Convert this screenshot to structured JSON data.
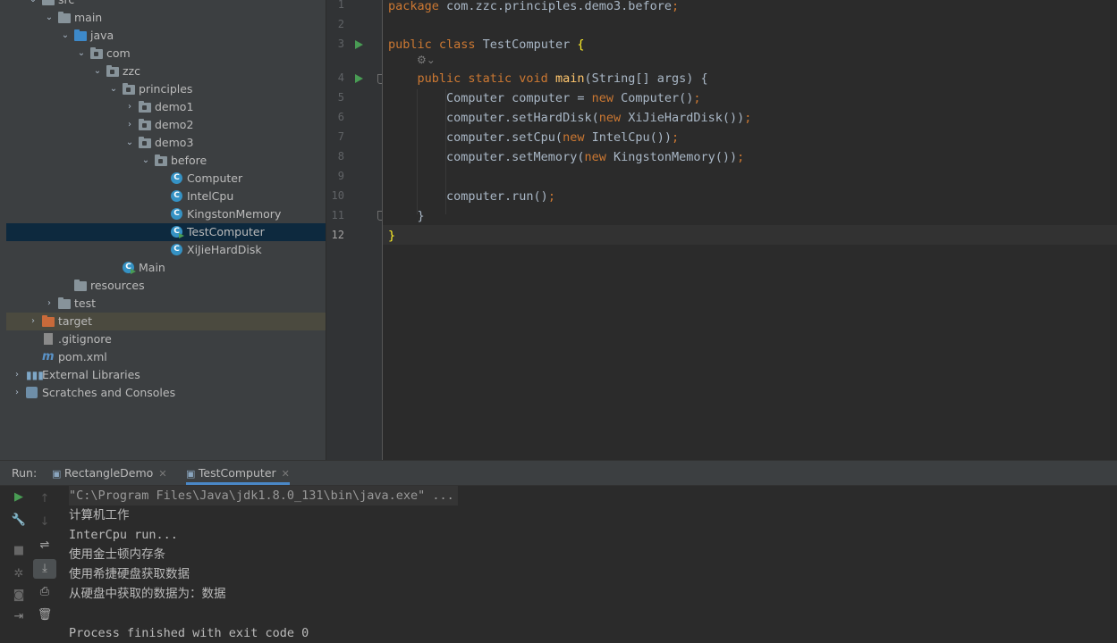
{
  "project_tree": [
    {
      "label": "src",
      "depth": 1,
      "arrow": "down",
      "icon": "folder-icon",
      "state": ""
    },
    {
      "label": "main",
      "depth": 2,
      "arrow": "down",
      "icon": "folder-icon",
      "state": ""
    },
    {
      "label": "java",
      "depth": 3,
      "arrow": "down",
      "icon": "source-folder-icon",
      "state": ""
    },
    {
      "label": "com",
      "depth": 4,
      "arrow": "down",
      "icon": "package-icon",
      "state": ""
    },
    {
      "label": "zzc",
      "depth": 5,
      "arrow": "down",
      "icon": "package-icon",
      "state": ""
    },
    {
      "label": "principles",
      "depth": 6,
      "arrow": "down",
      "icon": "package-icon",
      "state": ""
    },
    {
      "label": "demo1",
      "depth": 7,
      "arrow": "right",
      "icon": "package-icon",
      "state": ""
    },
    {
      "label": "demo2",
      "depth": 7,
      "arrow": "right",
      "icon": "package-icon",
      "state": ""
    },
    {
      "label": "demo3",
      "depth": 7,
      "arrow": "down",
      "icon": "package-icon",
      "state": ""
    },
    {
      "label": "before",
      "depth": 8,
      "arrow": "down",
      "icon": "package-icon",
      "state": ""
    },
    {
      "label": "Computer",
      "depth": 9,
      "arrow": "",
      "icon": "class-icon",
      "state": ""
    },
    {
      "label": "IntelCpu",
      "depth": 9,
      "arrow": "",
      "icon": "class-icon",
      "state": ""
    },
    {
      "label": "KingstonMemory",
      "depth": 9,
      "arrow": "",
      "icon": "class-icon",
      "state": ""
    },
    {
      "label": "TestComputer",
      "depth": 9,
      "arrow": "",
      "icon": "runnable-class-icon",
      "state": "selected"
    },
    {
      "label": "XiJieHardDisk",
      "depth": 9,
      "arrow": "",
      "icon": "class-icon",
      "state": ""
    },
    {
      "label": "Main",
      "depth": 6,
      "arrow": "",
      "icon": "runnable-class-icon",
      "state": ""
    },
    {
      "label": "resources",
      "depth": 3,
      "arrow": "",
      "icon": "resources-folder-icon",
      "state": ""
    },
    {
      "label": "test",
      "depth": 2,
      "arrow": "right",
      "icon": "folder-icon",
      "state": ""
    },
    {
      "label": "target",
      "depth": 1,
      "arrow": "right",
      "icon": "excluded-folder-icon",
      "state": "excluded"
    },
    {
      "label": ".gitignore",
      "depth": 1,
      "arrow": "",
      "icon": "gitignore-file-icon",
      "state": ""
    },
    {
      "label": "pom.xml",
      "depth": 1,
      "arrow": "",
      "icon": "maven-file-icon",
      "state": ""
    },
    {
      "label": "External Libraries",
      "depth": 0,
      "arrow": "right",
      "icon": "libraries-icon",
      "state": ""
    },
    {
      "label": "Scratches and Consoles",
      "depth": 0,
      "arrow": "right",
      "icon": "scratches-icon",
      "state": ""
    }
  ],
  "editor": {
    "line_numbers": [
      "1",
      "2",
      "3",
      "4",
      "5",
      "6",
      "7",
      "8",
      "9",
      "10",
      "11",
      "12"
    ],
    "current_line": "12",
    "code_lines": [
      [
        {
          "t": "package ",
          "c": "kw"
        },
        {
          "t": "com.zzc.principles.demo3.before",
          "c": ""
        },
        {
          "t": ";",
          "c": "kw"
        }
      ],
      [],
      [
        {
          "t": "public class ",
          "c": "kw"
        },
        {
          "t": "TestComputer ",
          "c": ""
        },
        {
          "t": "{",
          "c": "br"
        }
      ],
      [
        {
          "t": "    public static void ",
          "c": "kw"
        },
        {
          "t": "main",
          "c": "fn"
        },
        {
          "t": "(String[] args) {",
          "c": ""
        }
      ],
      [
        {
          "t": "        Computer computer = ",
          "c": ""
        },
        {
          "t": "new ",
          "c": "kw"
        },
        {
          "t": "Computer()",
          "c": ""
        },
        {
          "t": ";",
          "c": "kw"
        }
      ],
      [
        {
          "t": "        computer.setHardDisk(",
          "c": ""
        },
        {
          "t": "new ",
          "c": "kw"
        },
        {
          "t": "XiJieHardDisk())",
          "c": ""
        },
        {
          "t": ";",
          "c": "kw"
        }
      ],
      [
        {
          "t": "        computer.setCpu(",
          "c": ""
        },
        {
          "t": "new ",
          "c": "kw"
        },
        {
          "t": "IntelCpu())",
          "c": ""
        },
        {
          "t": ";",
          "c": "kw"
        }
      ],
      [
        {
          "t": "        computer.setMemory(",
          "c": ""
        },
        {
          "t": "new ",
          "c": "kw"
        },
        {
          "t": "KingstonMemory())",
          "c": ""
        },
        {
          "t": ";",
          "c": "kw"
        }
      ],
      [],
      [
        {
          "t": "        computer.run()",
          "c": ""
        },
        {
          "t": ";",
          "c": "kw"
        }
      ],
      [
        {
          "t": "    }",
          "c": ""
        }
      ],
      [
        {
          "t": "}",
          "c": "br"
        }
      ]
    ]
  },
  "run_panel": {
    "title": "Run:",
    "tabs": [
      {
        "label": "RectangleDemo",
        "active": false
      },
      {
        "label": "TestComputer",
        "active": true
      }
    ],
    "console_lines": [
      "\"C:\\Program Files\\Java\\jdk1.8.0_131\\bin\\java.exe\" ...",
      "计算机工作",
      "InterCpu run...",
      "使用金士顿内存条",
      "使用希捷硬盘获取数据",
      "从硬盘中获取的数据为：数据",
      "",
      "Process finished with exit code 0"
    ]
  },
  "colors": {
    "keyword": "#cc7832",
    "method": "#ffc66d",
    "brace_match": "#ffef28",
    "selection": "#0d293e",
    "run_green": "#499c54"
  }
}
